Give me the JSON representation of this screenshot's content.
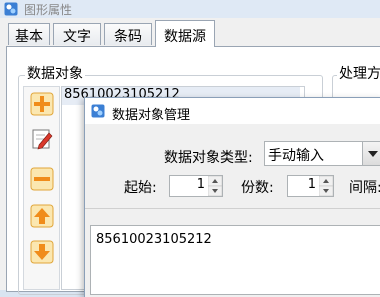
{
  "window": {
    "title": "图形属性"
  },
  "tabs": [
    {
      "label": "基本"
    },
    {
      "label": "文字"
    },
    {
      "label": "条码"
    },
    {
      "label": "数据源",
      "active": true
    }
  ],
  "data_object": {
    "section_label": "数据对象",
    "items": [
      "85610023105212"
    ]
  },
  "process": {
    "section_label": "处理方"
  },
  "toolbar": {
    "icons": [
      "add-icon",
      "edit-icon",
      "remove-icon",
      "move-up-icon",
      "move-down-icon"
    ]
  },
  "dialog": {
    "title": "数据对象管理",
    "type_label": "数据对象类型:",
    "type_value": "手动输入",
    "start_label": "起始:",
    "start_value": "1",
    "count_label": "份数:",
    "count_value": "1",
    "interval_label": "间隔:",
    "content": "85610023105212"
  },
  "colors": {
    "accent_orange": "#f5a623",
    "selection": "#e6ecf5",
    "border": "#9aa5b3"
  }
}
